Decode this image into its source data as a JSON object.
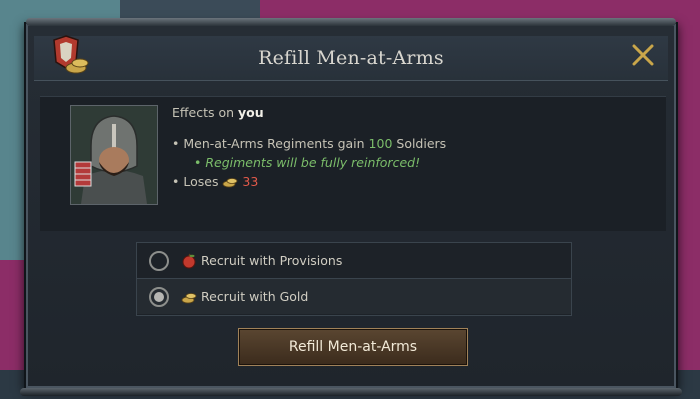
{
  "dialog": {
    "title": "Refill Men-at-Arms",
    "close_icon": "close-icon",
    "header_icon": "refill-shield-icon"
  },
  "effects": {
    "heading_prefix": "Effects on ",
    "heading_target": "you",
    "line1_prefix": "• Men-at-Arms Regiments gain ",
    "line1_value": "100",
    "line1_suffix": " Soldiers",
    "line2": "• Regiments will be fully reinforced!",
    "line3_prefix": "• Loses ",
    "line3_value": "33",
    "portrait_icon": "character-portrait"
  },
  "options": [
    {
      "label": "Recruit with Provisions",
      "icon": "provisions-apple-icon",
      "selected": false
    },
    {
      "label": "Recruit with Gold",
      "icon": "gold-coins-icon",
      "selected": true
    }
  ],
  "confirm_button": {
    "label": "Refill Men-at-Arms"
  },
  "colors": {
    "positive": "#7bbd6a",
    "negative": "#e25a4a",
    "gold": "#c9a64a"
  }
}
